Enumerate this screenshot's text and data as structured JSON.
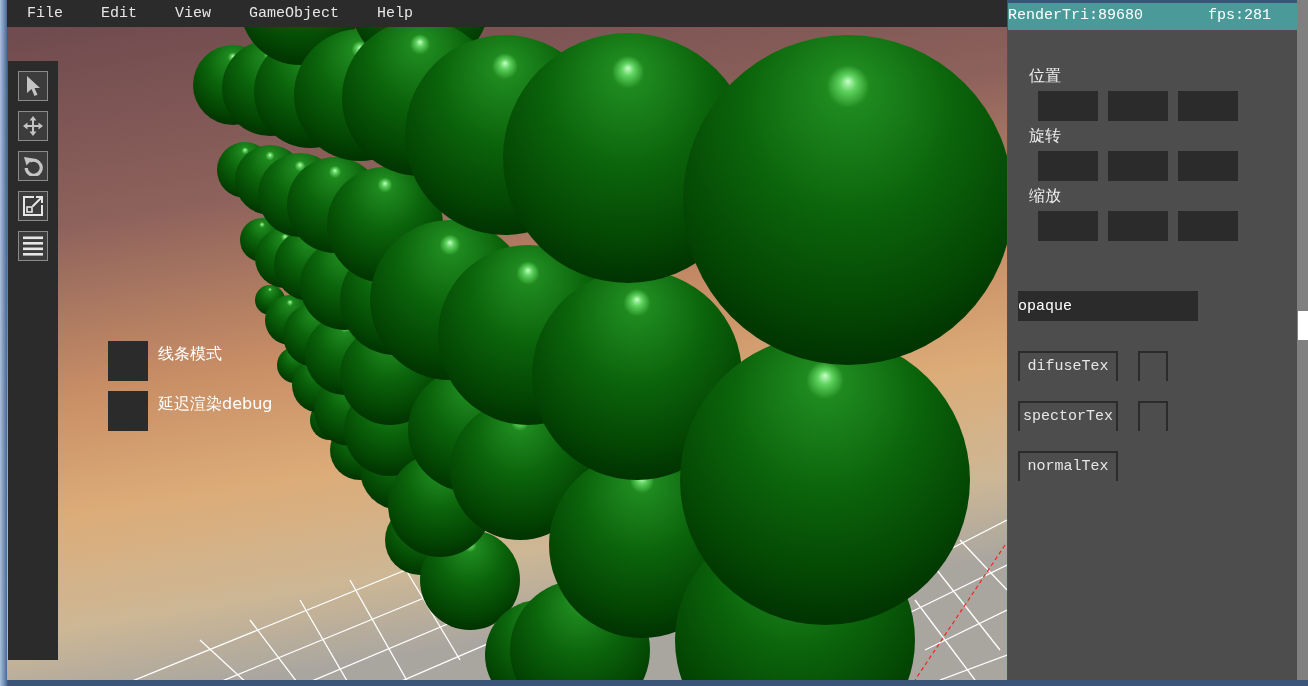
{
  "menu_bar": {
    "items": [
      {
        "label": "File"
      },
      {
        "label": "Edit"
      },
      {
        "label": "View"
      },
      {
        "label": "GameObject"
      },
      {
        "label": "Help"
      }
    ]
  },
  "toolbar": {
    "tools": [
      {
        "kind": "select"
      },
      {
        "kind": "move"
      },
      {
        "kind": "rotate"
      },
      {
        "kind": "scale"
      },
      {
        "kind": "menu"
      }
    ]
  },
  "viewport_options": [
    {
      "label": "线条模式",
      "checked": false
    },
    {
      "label": "延迟渲染debug",
      "checked": false
    }
  ],
  "stats_bar": {
    "triangles": "RenderTri:89680",
    "fps": "fps:281"
  },
  "inspector": {
    "groups": [
      {
        "label": "位置"
      },
      {
        "label": "旋转"
      },
      {
        "label": "缩放"
      }
    ],
    "mode_field": {
      "value": "opaque"
    },
    "textures": [
      {
        "label": "difuseTex",
        "kind": "with-slot"
      },
      {
        "label": "spectorTex",
        "kind": "with-slot"
      },
      {
        "label": "normalTex",
        "kind": "plain"
      }
    ]
  }
}
